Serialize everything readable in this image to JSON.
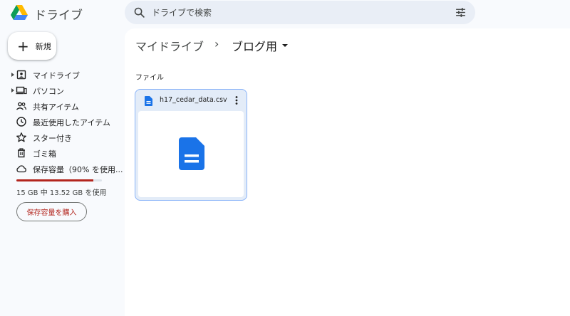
{
  "app": {
    "title": "ドライブ"
  },
  "search": {
    "placeholder": "ドライブで検索"
  },
  "sidebar": {
    "new_label": "新規",
    "items": [
      {
        "label": "マイドライブ",
        "icon": "my-drive-icon",
        "expandable": true
      },
      {
        "label": "パソコン",
        "icon": "computers-icon",
        "expandable": true
      },
      {
        "label": "共有アイテム",
        "icon": "shared-icon",
        "expandable": false
      },
      {
        "label": "最近使用したアイテム",
        "icon": "clock-icon",
        "expandable": false
      },
      {
        "label": "スター付き",
        "icon": "star-icon",
        "expandable": false
      },
      {
        "label": "ゴミ箱",
        "icon": "trash-icon",
        "expandable": false
      },
      {
        "label": "保存容量（90% を使用...",
        "icon": "cloud-icon",
        "expandable": false
      }
    ],
    "storage": {
      "used_percent": 90,
      "text": "15 GB 中 13.52 GB を使用"
    },
    "buy_label": "保存容量を購入"
  },
  "breadcrumb": {
    "root": "マイドライブ",
    "separator": "›",
    "current": "ブログ用"
  },
  "main": {
    "section_label": "ファイル",
    "files": [
      {
        "name": "h17_cedar_data.csv",
        "icon": "doc-icon"
      }
    ]
  },
  "colors": {
    "accent": "#1a73e8",
    "warning": "#b3261e",
    "search_bg": "#e9eef6",
    "card_bg": "#e3ecf8"
  }
}
